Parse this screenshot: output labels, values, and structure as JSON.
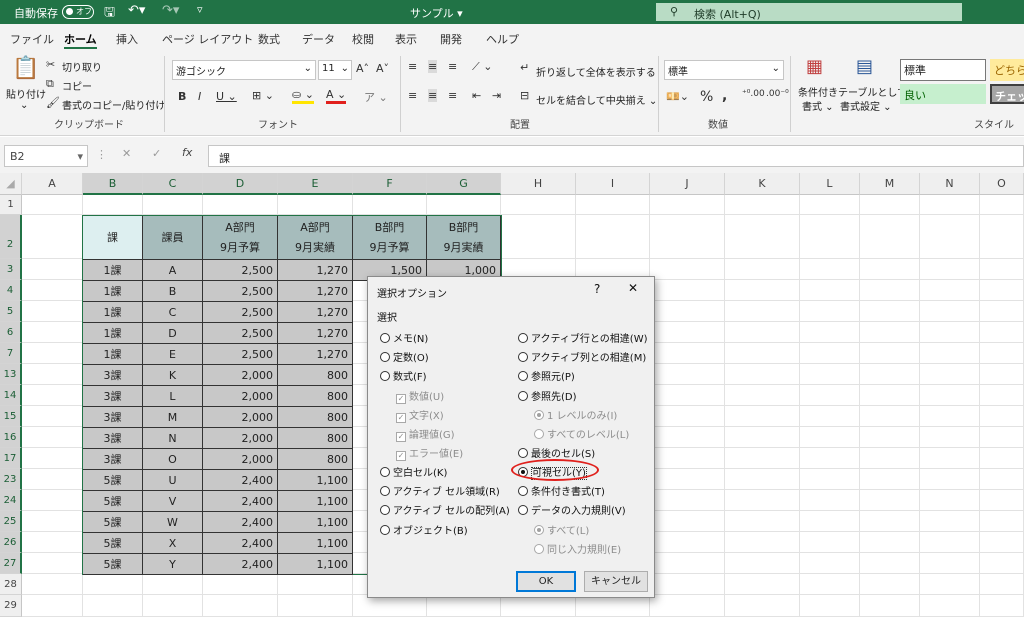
{
  "titlebar": {
    "autosave": "自動保存",
    "autosave_state": "オフ",
    "doc_title": "サンプル ▾",
    "search": "検索 (Alt+Q)"
  },
  "tabs": [
    "ファイル",
    "ホーム",
    "挿入",
    "ページ レイアウト",
    "数式",
    "データ",
    "校閲",
    "表示",
    "開発",
    "ヘルプ"
  ],
  "ribbon": {
    "paste": "貼り付け",
    "cut": "切り取り",
    "copy": "コピー",
    "format_painter": "書式のコピー/貼り付け",
    "clipboard": "クリップボード",
    "font_name": "游ゴシック",
    "font_size": "11",
    "font": "フォント",
    "wrap": "折り返して全体を表示する",
    "merge": "セルを結合して中央揃え",
    "alignment": "配置",
    "number_format": "標準",
    "number": "数値",
    "cond_fmt1": "条件付き",
    "cond_fmt2": "書式",
    "table_fmt1": "テーブルとして",
    "table_fmt2": "書式設定",
    "style_normal": "標準",
    "style_good": "良い",
    "style_neutral": "どちら",
    "style_check": "チェッ",
    "styles": "スタイル"
  },
  "formula": {
    "namebox": "B2",
    "content": "課"
  },
  "columns": [
    "A",
    "B",
    "C",
    "D",
    "E",
    "F",
    "G",
    "H",
    "I",
    "J",
    "K",
    "L",
    "M",
    "N",
    "O"
  ],
  "rows": [
    "1",
    "2",
    "3",
    "4",
    "5",
    "6",
    "7",
    "13",
    "14",
    "15",
    "16",
    "17",
    "23",
    "24",
    "25",
    "26",
    "27",
    "28",
    "29"
  ],
  "table": {
    "header": [
      "課",
      "課員",
      "A部門",
      "A部門",
      "B部門",
      "B部門"
    ],
    "header2": [
      "",
      "",
      "9月予算",
      "9月実績",
      "9月予算",
      "9月実績"
    ],
    "data": [
      [
        "1課",
        "A",
        "2,500",
        "1,270",
        "1,500",
        "1,000"
      ],
      [
        "1課",
        "B",
        "2,500",
        "1,270",
        "",
        ""
      ],
      [
        "1課",
        "C",
        "2,500",
        "1,270",
        "",
        ""
      ],
      [
        "1課",
        "D",
        "2,500",
        "1,270",
        "",
        ""
      ],
      [
        "1課",
        "E",
        "2,500",
        "1,270",
        "",
        ""
      ],
      [
        "3課",
        "K",
        "2,000",
        "800",
        "",
        ""
      ],
      [
        "3課",
        "L",
        "2,000",
        "800",
        "",
        ""
      ],
      [
        "3課",
        "M",
        "2,000",
        "800",
        "",
        ""
      ],
      [
        "3課",
        "N",
        "2,000",
        "800",
        "",
        ""
      ],
      [
        "3課",
        "O",
        "2,000",
        "800",
        "",
        ""
      ],
      [
        "5課",
        "U",
        "2,400",
        "1,100",
        "",
        ""
      ],
      [
        "5課",
        "V",
        "2,400",
        "1,100",
        "",
        ""
      ],
      [
        "5課",
        "W",
        "2,400",
        "1,100",
        "",
        ""
      ],
      [
        "5課",
        "X",
        "2,400",
        "1,100",
        "",
        ""
      ],
      [
        "5課",
        "Y",
        "2,400",
        "1,100",
        "",
        ""
      ]
    ]
  },
  "dialog": {
    "title": "選択オプション",
    "help": "?",
    "close": "✕",
    "section": "選択",
    "left": [
      "メモ(N)",
      "定数(O)",
      "数式(F)",
      "数値(U)",
      "文字(X)",
      "論理値(G)",
      "エラー値(E)",
      "空白セル(K)",
      "アクティブ セル領域(R)",
      "アクティブ セルの配列(A)",
      "オブジェクト(B)"
    ],
    "right": [
      "アクティブ行との相違(W)",
      "アクティブ列との相違(M)",
      "参照元(P)",
      "参照先(D)",
      "1 レベルのみ(I)",
      "すべてのレベル(L)",
      "最後のセル(S)",
      "可視セル(Y)",
      "条件付き書式(T)",
      "データの入力規則(V)",
      "すべて(L)",
      "同じ入力規則(E)"
    ],
    "ok": "OK",
    "cancel": "キャンセル"
  },
  "colors": {
    "accent": "#217346",
    "highlight_ring": "#e0201c"
  }
}
